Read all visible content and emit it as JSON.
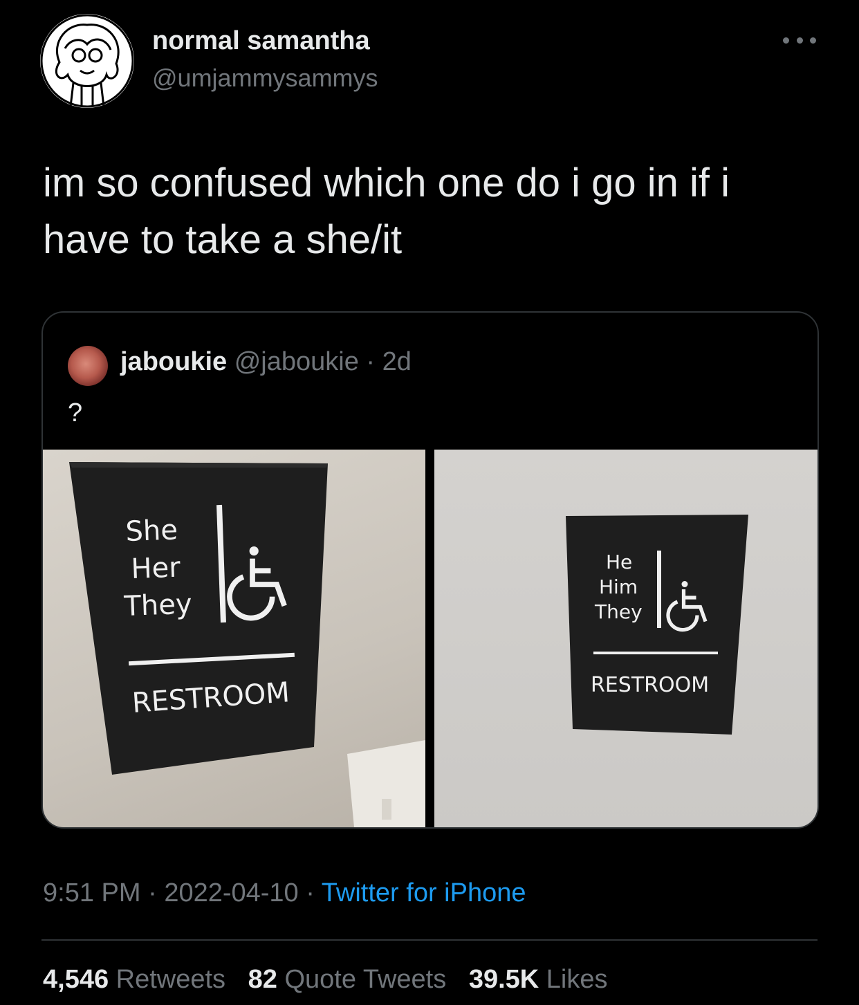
{
  "tweet": {
    "display_name": "normal samantha",
    "handle": "@umjammysammys",
    "text": "im so confused which one do i go in if i have to take a she/it",
    "more_icon": "more-horizontal-icon"
  },
  "quoted": {
    "display_name": "jaboukie",
    "handle": "@jaboukie",
    "time": "· 2d",
    "text": "?",
    "images": [
      {
        "sign_lines": [
          "She",
          "Her",
          "They"
        ],
        "sign_bottom": "RESTROOM",
        "icon": "wheelchair-accessible-icon"
      },
      {
        "sign_lines": [
          "He",
          "Him",
          "They"
        ],
        "sign_bottom": "RESTROOM",
        "icon": "wheelchair-accessible-icon"
      }
    ]
  },
  "footer": {
    "time": "9:51 PM",
    "sep1": " · ",
    "date": "2022-04-10",
    "sep2": " · ",
    "client": "Twitter for iPhone"
  },
  "stats": {
    "retweets_num": "4,546",
    "retweets_lbl": "Retweets",
    "quotes_num": "82",
    "quotes_lbl": "Quote Tweets",
    "likes_num": "39.5K",
    "likes_lbl": "Likes"
  },
  "colors": {
    "background": "#000000",
    "text": "#e7e9ea",
    "secondary": "#71767b",
    "link": "#1d9bf0",
    "border": "#2f3336"
  }
}
